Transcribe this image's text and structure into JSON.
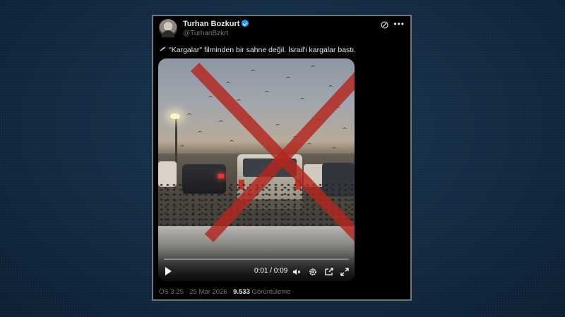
{
  "tweet": {
    "author_name": "Turhan Bozkurt",
    "author_handle": "@TurhanBzkrt",
    "more_icon": "•••",
    "text": "\"Kargalar\" filminden bir sahne değil. İsrail'i kargalar bastı.",
    "timestamp": "ÖS 3:25 · 25 Mar 2026 ·",
    "views_count": "9.533",
    "views_label": "Görüntüleme"
  },
  "video": {
    "time_display": "0:01 / 0:09",
    "progress": 0.11
  },
  "colors": {
    "verified": "#1d9bf0",
    "cross": "#b3261e",
    "background": "#132a42"
  },
  "icons": [
    "avatar",
    "verified-badge-icon",
    "grok-icon",
    "more-icon",
    "bird-emoji-icon",
    "play-icon",
    "volume-muted-icon",
    "settings-icon",
    "fullscreen-enter-icon",
    "expand-icon"
  ]
}
